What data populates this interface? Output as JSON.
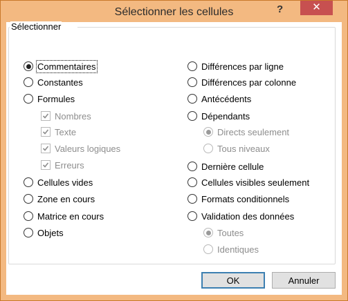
{
  "window": {
    "title": "Sélectionner les cellules",
    "help_glyph": "?",
    "close_glyph": "✕"
  },
  "group": {
    "legend": "Sélectionner"
  },
  "left_options": [
    {
      "label": "Commentaires",
      "selected": true
    },
    {
      "label": "Constantes",
      "selected": false
    },
    {
      "label": "Formules",
      "selected": false
    },
    {
      "label": "Nombres",
      "checked": true,
      "disabled": true
    },
    {
      "label": "Texte",
      "checked": true,
      "disabled": true
    },
    {
      "label": "Valeurs logiques",
      "checked": true,
      "disabled": true
    },
    {
      "label": "Erreurs",
      "checked": true,
      "disabled": true
    },
    {
      "label": "Cellules vides",
      "selected": false
    },
    {
      "label": "Zone en cours",
      "selected": false
    },
    {
      "label": "Matrice en cours",
      "selected": false
    },
    {
      "label": "Objets",
      "selected": false
    }
  ],
  "right_options": [
    {
      "label": "Différences par ligne",
      "selected": false
    },
    {
      "label": "Différences par colonne",
      "selected": false
    },
    {
      "label": "Antécédents",
      "selected": false
    },
    {
      "label": "Dépendants",
      "selected": false
    },
    {
      "label": "Directs seulement",
      "selected": true,
      "disabled": true
    },
    {
      "label": "Tous niveaux",
      "selected": false,
      "disabled": true
    },
    {
      "label": "Dernière cellule",
      "selected": false
    },
    {
      "label": "Cellules visibles seulement",
      "selected": false
    },
    {
      "label": "Formats conditionnels",
      "selected": false
    },
    {
      "label": "Validation des données",
      "selected": false
    },
    {
      "label": "Toutes",
      "selected": true,
      "disabled": true
    },
    {
      "label": "Identiques",
      "selected": false,
      "disabled": true
    }
  ],
  "buttons": {
    "ok": "OK",
    "cancel": "Annuler"
  }
}
